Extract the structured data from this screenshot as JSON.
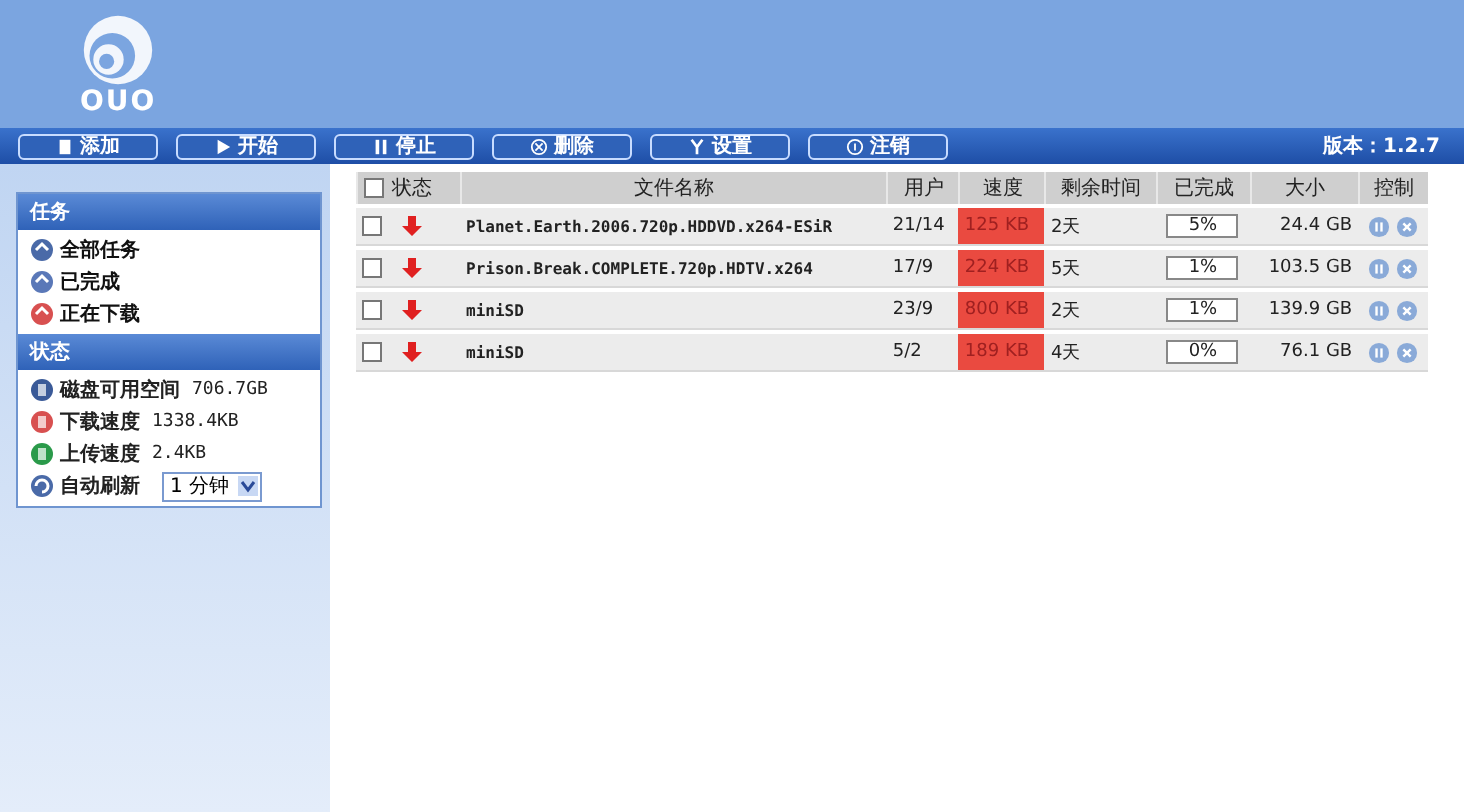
{
  "logo": {
    "text": "OUO"
  },
  "toolbar": {
    "buttons": [
      {
        "label": "添加"
      },
      {
        "label": "开始"
      },
      {
        "label": "停止"
      },
      {
        "label": "删除"
      },
      {
        "label": "设置"
      },
      {
        "label": "注销"
      }
    ],
    "version": "版本：1.2.7"
  },
  "sidebar": {
    "tasks_title": "任务",
    "tasks": [
      {
        "label": "全部任务"
      },
      {
        "label": "已完成"
      },
      {
        "label": "正在下载"
      }
    ],
    "status_title": "状态",
    "status": [
      {
        "label": "磁盘可用空间",
        "value": "706.7GB"
      },
      {
        "label": "下载速度",
        "value": "1338.4KB"
      },
      {
        "label": "上传速度",
        "value": "2.4KB"
      }
    ],
    "refresh": {
      "label": "自动刷新",
      "value": "1 分钟"
    }
  },
  "table": {
    "select_all_checked": false,
    "columns": [
      "状态",
      "文件名称",
      "用户",
      "速度",
      "剩余时间",
      "已完成",
      "大小",
      "控制"
    ],
    "rows": [
      {
        "checked": false,
        "name": "Planet.Earth.2006.720p.HDDVD.x264-ESiR",
        "users": "21/14",
        "speed": "125 KB",
        "remaining": "2天",
        "done": "5%",
        "size": "24.4 GB"
      },
      {
        "checked": false,
        "name": "Prison.Break.COMPLETE.720p.HDTV.x264",
        "users": "17/9",
        "speed": "224 KB",
        "remaining": "5天",
        "done": "1%",
        "size": "103.5 GB"
      },
      {
        "checked": false,
        "name": "miniSD",
        "users": "23/9",
        "speed": "800 KB",
        "remaining": "2天",
        "done": "1%",
        "size": "139.9 GB"
      },
      {
        "checked": false,
        "name": "miniSD",
        "users": "5/2",
        "speed": "189 KB",
        "remaining": "4天",
        "done": "0%",
        "size": "76.1 GB"
      }
    ]
  }
}
